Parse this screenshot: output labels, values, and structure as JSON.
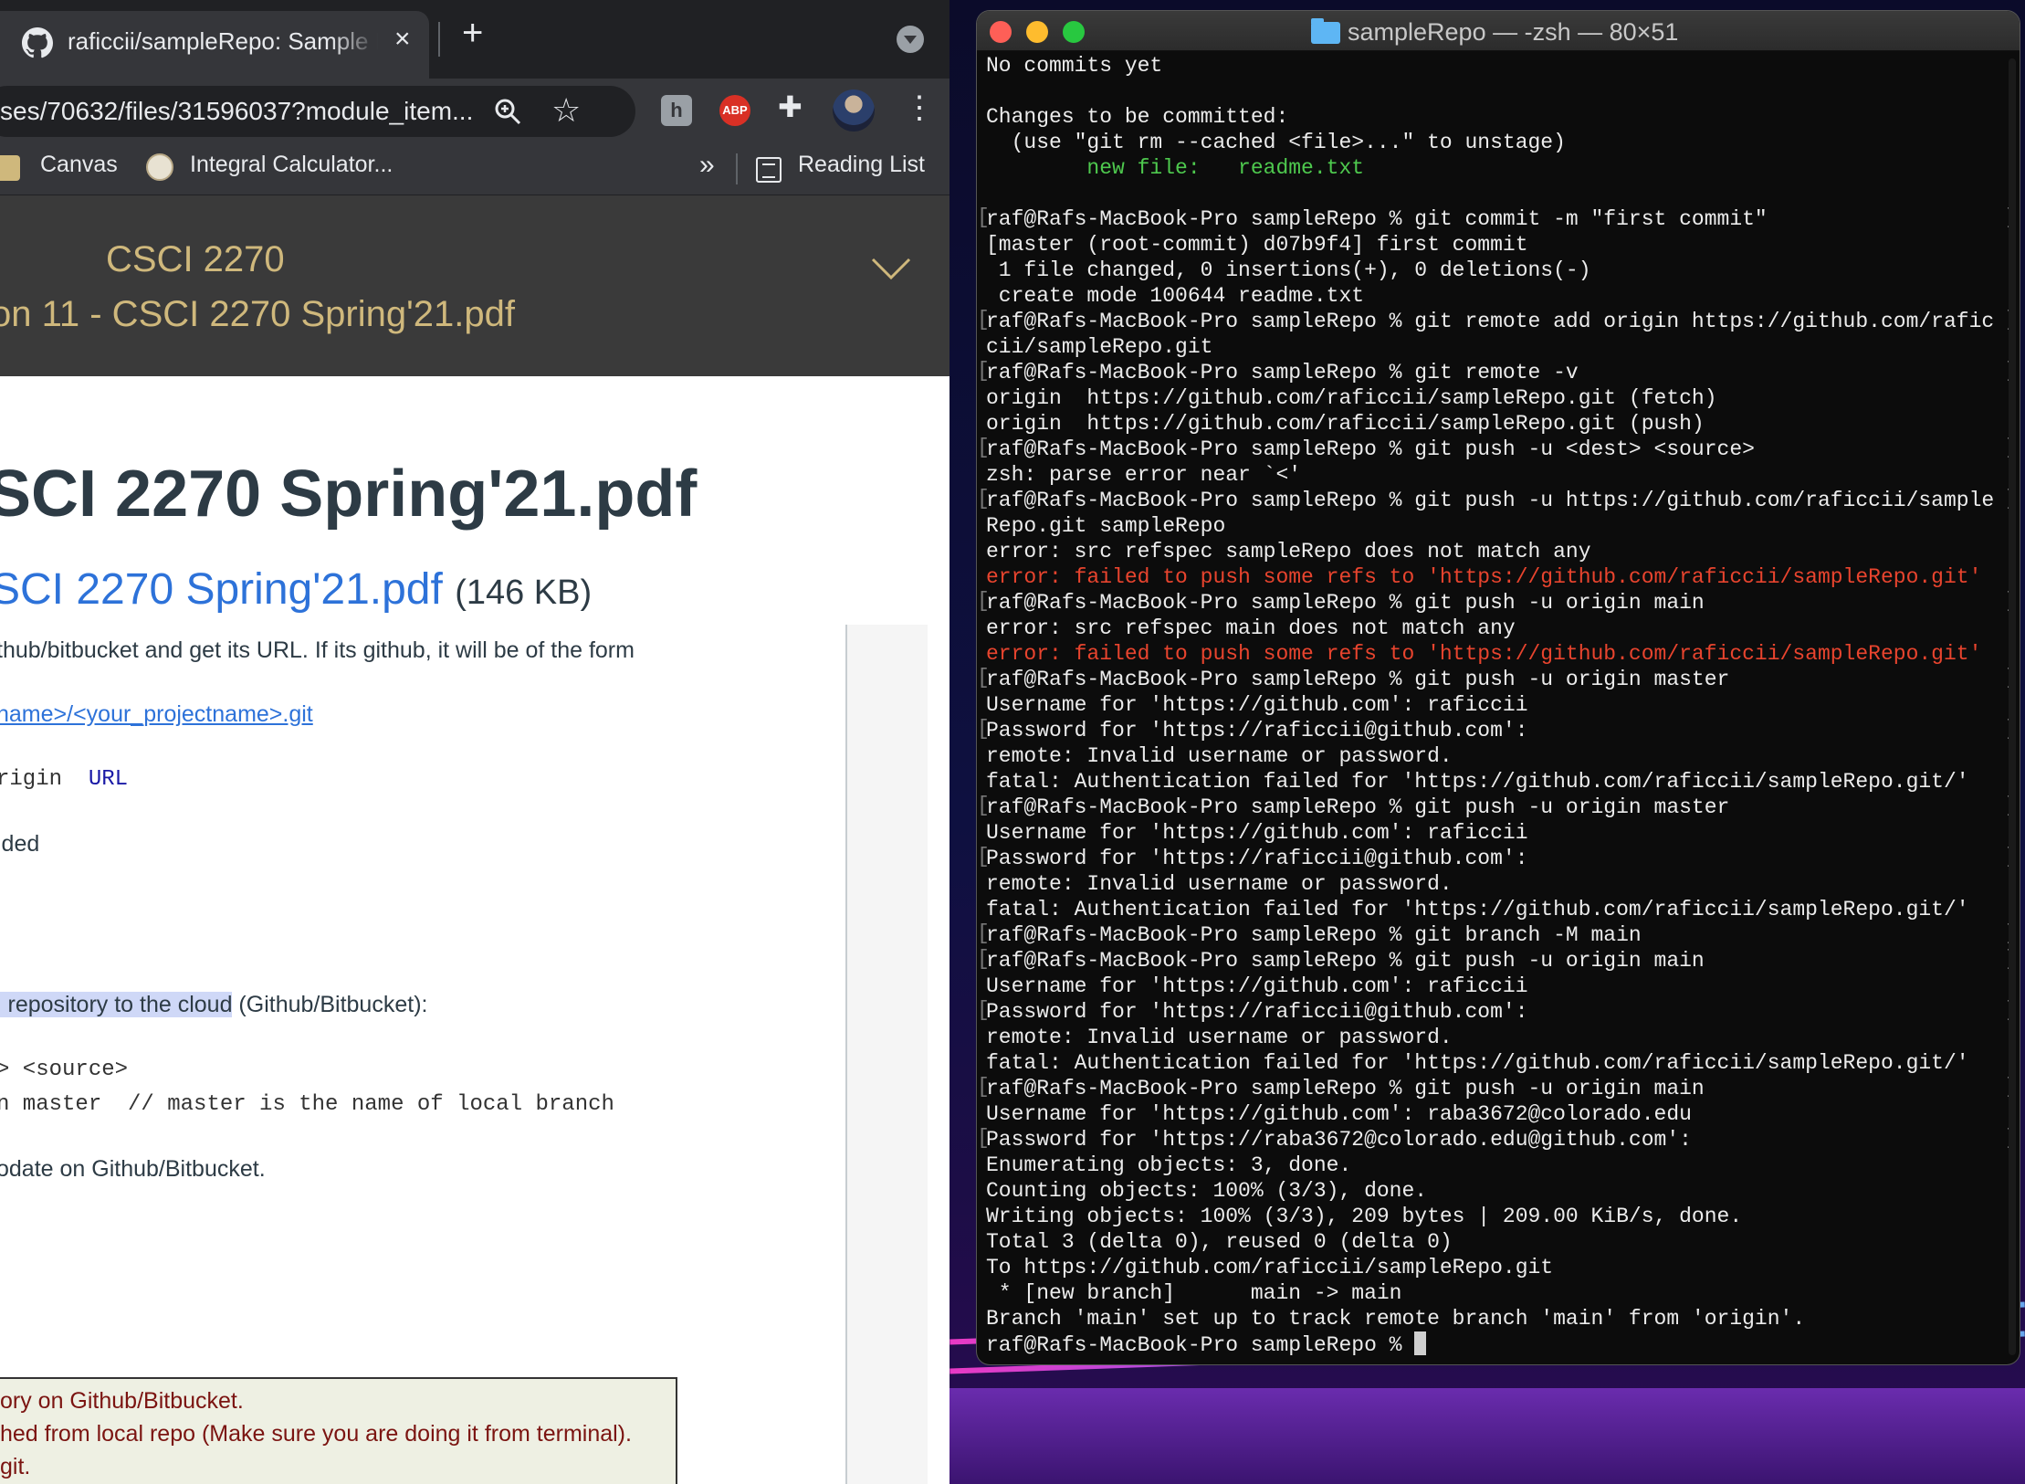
{
  "browser": {
    "tab_title": "raficcii/sampleRepo: Sample Re",
    "tab_close": "×",
    "new_tab": "+",
    "url": "ses/70632/files/31596037?module_item...",
    "bookmarks": [
      {
        "label": "Canvas"
      },
      {
        "label": "Integral Calculator..."
      }
    ],
    "bookmarks_more": "»",
    "reading_list": "Reading List",
    "extensions": {
      "abp": "ABP",
      "h": "h"
    }
  },
  "canvas": {
    "course_code": "CSCI 2270",
    "file_title": "on 11 - CSCI 2270 Spring'21.pdf",
    "page_heading": "SCI 2270 Spring'21.pdf",
    "file_link": "SCI 2270 Spring'21.pdf",
    "file_size": "(146 KB)",
    "para1": "thub/bitbucket and get its URL. If its github, it will be of the form",
    "url_pattern": "name>/<your_projectname>.git",
    "code_origin_prefix": "rigin  ",
    "code_origin_url": "URL",
    "added_text": "lded",
    "push_section_highlight": "l repository to the cloud",
    "push_section_rest": " (Github/Bitbucket):",
    "code_dest_source": "> <source>",
    "code_master": "n master  // master is the name of local branch",
    "update_text": "odate on Github/Bitbucket.",
    "notice_lines": [
      "ory on Github/Bitbucket.",
      "hed from local repo (Make sure you are doing it from terminal).",
      " git."
    ]
  },
  "terminal": {
    "title": "sampleRepo — -zsh — 80×51",
    "lines": [
      {
        "text": "No commits yet",
        "color": "normal",
        "bracket": false
      },
      {
        "text": "",
        "color": "normal",
        "bracket": false
      },
      {
        "text": "Changes to be committed:",
        "color": "normal",
        "bracket": false
      },
      {
        "text": "  (use \"git rm --cached <file>...\" to unstage)",
        "color": "normal",
        "bracket": false
      },
      {
        "text": "        new file:   readme.txt",
        "color": "green",
        "bracket": false
      },
      {
        "text": "",
        "color": "normal",
        "bracket": false
      },
      {
        "text": "raf@Rafs-MacBook-Pro sampleRepo % git commit -m \"first commit\"",
        "color": "normal",
        "bracket": true
      },
      {
        "text": "[master (root-commit) d07b9f4] first commit",
        "color": "normal",
        "bracket": false
      },
      {
        "text": " 1 file changed, 0 insertions(+), 0 deletions(-)",
        "color": "normal",
        "bracket": false
      },
      {
        "text": " create mode 100644 readme.txt",
        "color": "normal",
        "bracket": false
      },
      {
        "text": "raf@Rafs-MacBook-Pro sampleRepo % git remote add origin https://github.com/rafic",
        "color": "normal",
        "bracket": true
      },
      {
        "text": "cii/sampleRepo.git",
        "color": "normal",
        "bracket": false
      },
      {
        "text": "raf@Rafs-MacBook-Pro sampleRepo % git remote -v",
        "color": "normal",
        "bracket": true
      },
      {
        "text": "origin  https://github.com/raficcii/sampleRepo.git (fetch)",
        "color": "normal",
        "bracket": false
      },
      {
        "text": "origin  https://github.com/raficcii/sampleRepo.git (push)",
        "color": "normal",
        "bracket": false
      },
      {
        "text": "raf@Rafs-MacBook-Pro sampleRepo % git push -u <dest> <source>",
        "color": "normal",
        "bracket": true
      },
      {
        "text": "zsh: parse error near `<'",
        "color": "normal",
        "bracket": false
      },
      {
        "text": "raf@Rafs-MacBook-Pro sampleRepo % git push -u https://github.com/raficcii/sample",
        "color": "normal",
        "bracket": true
      },
      {
        "text": "Repo.git sampleRepo",
        "color": "normal",
        "bracket": false
      },
      {
        "text": "error: src refspec sampleRepo does not match any",
        "color": "normal",
        "bracket": false
      },
      {
        "text": "error: failed to push some refs to 'https://github.com/raficcii/sampleRepo.git'",
        "color": "red",
        "bracket": false
      },
      {
        "text": "raf@Rafs-MacBook-Pro sampleRepo % git push -u origin main",
        "color": "normal",
        "bracket": true
      },
      {
        "text": "error: src refspec main does not match any",
        "color": "normal",
        "bracket": false
      },
      {
        "text": "error: failed to push some refs to 'https://github.com/raficcii/sampleRepo.git'",
        "color": "red",
        "bracket": false
      },
      {
        "text": "raf@Rafs-MacBook-Pro sampleRepo % git push -u origin master",
        "color": "normal",
        "bracket": true
      },
      {
        "text": "Username for 'https://github.com': raficcii",
        "color": "normal",
        "bracket": false
      },
      {
        "text": "Password for 'https://raficcii@github.com':",
        "color": "normal",
        "bracket": true
      },
      {
        "text": "remote: Invalid username or password.",
        "color": "normal",
        "bracket": false
      },
      {
        "text": "fatal: Authentication failed for 'https://github.com/raficcii/sampleRepo.git/'",
        "color": "normal",
        "bracket": false
      },
      {
        "text": "raf@Rafs-MacBook-Pro sampleRepo % git push -u origin master",
        "color": "normal",
        "bracket": true
      },
      {
        "text": "Username for 'https://github.com': raficcii",
        "color": "normal",
        "bracket": false
      },
      {
        "text": "Password for 'https://raficcii@github.com':",
        "color": "normal",
        "bracket": true
      },
      {
        "text": "remote: Invalid username or password.",
        "color": "normal",
        "bracket": false
      },
      {
        "text": "fatal: Authentication failed for 'https://github.com/raficcii/sampleRepo.git/'",
        "color": "normal",
        "bracket": false
      },
      {
        "text": "raf@Rafs-MacBook-Pro sampleRepo % git branch -M main",
        "color": "normal",
        "bracket": true
      },
      {
        "text": "raf@Rafs-MacBook-Pro sampleRepo % git push -u origin main",
        "color": "normal",
        "bracket": true
      },
      {
        "text": "Username for 'https://github.com': raficcii",
        "color": "normal",
        "bracket": false
      },
      {
        "text": "Password for 'https://raficcii@github.com':",
        "color": "normal",
        "bracket": true
      },
      {
        "text": "remote: Invalid username or password.",
        "color": "normal",
        "bracket": false
      },
      {
        "text": "fatal: Authentication failed for 'https://github.com/raficcii/sampleRepo.git/'",
        "color": "normal",
        "bracket": false
      },
      {
        "text": "raf@Rafs-MacBook-Pro sampleRepo % git push -u origin main",
        "color": "normal",
        "bracket": true
      },
      {
        "text": "Username for 'https://github.com': raba3672@colorado.edu",
        "color": "normal",
        "bracket": false
      },
      {
        "text": "Password for 'https://raba3672@colorado.edu@github.com':",
        "color": "normal",
        "bracket": true
      },
      {
        "text": "Enumerating objects: 3, done.",
        "color": "normal",
        "bracket": false
      },
      {
        "text": "Counting objects: 100% (3/3), done.",
        "color": "normal",
        "bracket": false
      },
      {
        "text": "Writing objects: 100% (3/3), 209 bytes | 209.00 KiB/s, done.",
        "color": "normal",
        "bracket": false
      },
      {
        "text": "Total 3 (delta 0), reused 0 (delta 0)",
        "color": "normal",
        "bracket": false
      },
      {
        "text": "To https://github.com/raficcii/sampleRepo.git",
        "color": "normal",
        "bracket": false
      },
      {
        "text": " * [new branch]      main -> main",
        "color": "normal",
        "bracket": false
      },
      {
        "text": "Branch 'main' set up to track remote branch 'main' from 'origin'.",
        "color": "normal",
        "bracket": false
      },
      {
        "text": "raf@Rafs-MacBook-Pro sampleRepo % ",
        "color": "normal",
        "bracket": false,
        "cursor": true
      }
    ]
  },
  "colors": {
    "canvas_gold": "#cfb87c",
    "link_blue": "#2d72d9",
    "terminal_green": "#4ec94e",
    "terminal_red": "#e8442e"
  }
}
